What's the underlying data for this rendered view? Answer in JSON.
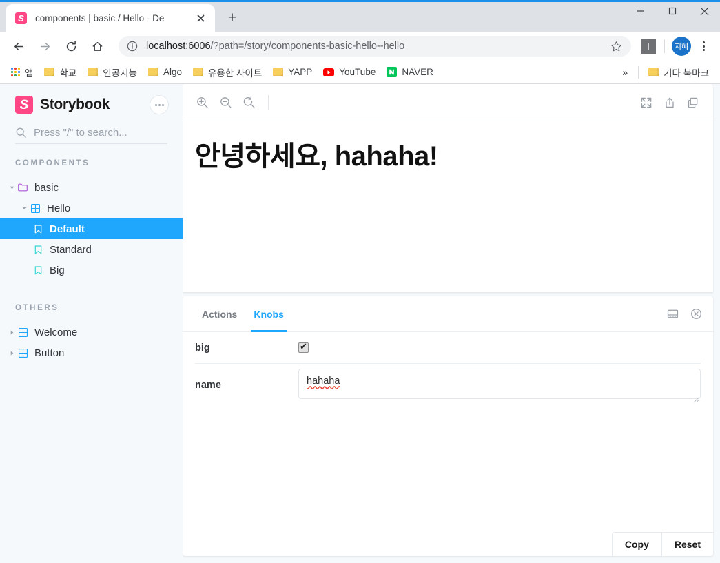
{
  "browser": {
    "tab": {
      "title": "components | basic / Hello - De",
      "favicon_icon": "storybook-favicon",
      "favicon_letter": "S",
      "close_icon": "close-icon"
    },
    "new_tab_label": "+",
    "window_controls": {
      "minimize": "minimize-icon",
      "maximize": "maximize-icon",
      "close": "close-icon"
    },
    "toolbar": {
      "back_icon": "back-arrow-icon",
      "forward_icon": "forward-arrow-icon",
      "reload_icon": "reload-icon",
      "home_icon": "home-icon",
      "site_info_icon": "info-circle-icon",
      "url_scheme_host": "localhost:6006",
      "url_path": "/?path=/story/components-basic-hello--hello",
      "url_full": "localhost:6006/?path=/story/components-basic-hello--hello",
      "bookmark_star_icon": "star-outline-icon",
      "extension_label": "I",
      "profile_initials": "지혜",
      "menu_icon": "three-dot-menu-icon"
    },
    "bookmarks": {
      "apps_label": "앱",
      "items": [
        {
          "label": "학교",
          "icon": "folder-icon"
        },
        {
          "label": "인공지능",
          "icon": "folder-icon"
        },
        {
          "label": "Algo",
          "icon": "folder-icon"
        },
        {
          "label": "유용한 사이트",
          "icon": "folder-icon"
        },
        {
          "label": "YAPP",
          "icon": "folder-icon"
        },
        {
          "label": "YouTube",
          "icon": "youtube-icon"
        },
        {
          "label": "NAVER",
          "icon": "naver-icon"
        }
      ],
      "overflow_label": "»",
      "other_bookmarks": {
        "label": "기타 북마크",
        "icon": "folder-icon"
      }
    }
  },
  "storybook": {
    "brand": {
      "name": "Storybook",
      "mark_letter": "S",
      "color": "#FF4785"
    },
    "menu_button_icon": "three-dot-menu-icon",
    "search": {
      "placeholder": "Press \"/\" to search...",
      "icon": "search-icon"
    },
    "tree": [
      {
        "section": "COMPONENTS",
        "rows": [
          {
            "label": "basic",
            "icon": "folder-icon",
            "depth": 0,
            "caret": "down",
            "selected": false
          },
          {
            "label": "Hello",
            "icon": "component-grid-icon",
            "depth": 1,
            "caret": "down",
            "selected": false
          },
          {
            "label": "Default",
            "icon": "story-bookmark-icon",
            "depth": 2,
            "caret": "none",
            "selected": true
          },
          {
            "label": "Standard",
            "icon": "story-bookmark-icon",
            "depth": 2,
            "caret": "none",
            "selected": false
          },
          {
            "label": "Big",
            "icon": "story-bookmark-icon",
            "depth": 2,
            "caret": "none",
            "selected": false
          }
        ]
      },
      {
        "section": "OTHERS",
        "rows": [
          {
            "label": "Welcome",
            "icon": "component-grid-icon",
            "depth": 0,
            "caret": "right",
            "selected": false
          },
          {
            "label": "Button",
            "icon": "component-grid-icon",
            "depth": 0,
            "caret": "right",
            "selected": false
          }
        ]
      }
    ],
    "preview_toolbar": {
      "zoom_in_icon": "zoom-in-icon",
      "zoom_out_icon": "zoom-out-icon",
      "zoom_reset_icon": "zoom-reset-icon",
      "fullscreen_icon": "fullscreen-icon",
      "open_in_new_tab_icon": "share-upload-icon",
      "copy_link_icon": "copy-icon"
    },
    "story": {
      "heading": "안녕하세요, hahaha!"
    },
    "panel": {
      "tabs": [
        {
          "label": "Actions",
          "active": false
        },
        {
          "label": "Knobs",
          "active": true
        }
      ],
      "layout_icon": "panel-position-icon",
      "close_icon": "close-circle-icon",
      "knobs": [
        {
          "label": "big",
          "type": "checkbox",
          "value": true
        },
        {
          "label": "name",
          "type": "text",
          "value": "hahaha"
        }
      ],
      "actions": {
        "copy_label": "Copy",
        "reset_label": "Reset"
      }
    }
  },
  "colors": {
    "accent_blue": "#1EA7FD",
    "brand_pink": "#FF4785",
    "sidebar_bg": "#F6F9FC",
    "chrome_bg": "#DEE1E6"
  }
}
